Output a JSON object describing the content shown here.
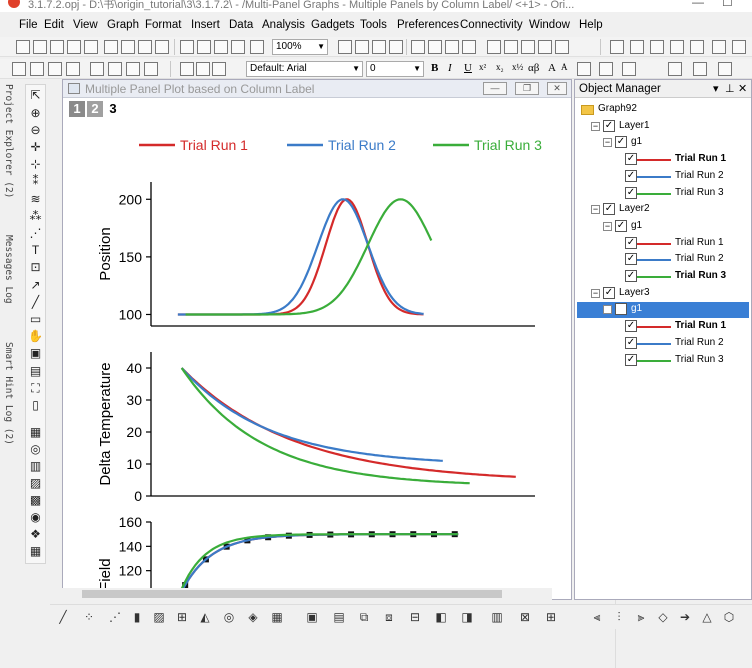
{
  "window": {
    "title": "3.1.7.2.opj - D:\\书\\origin_tutorial\\3\\3.1.7.2\\ - /Multi-Panel Graphs - Multiple Panels by Column Label/ <+1> - Ori..."
  },
  "menu": [
    "File",
    "Edit",
    "View",
    "Graph",
    "Format",
    "Insert",
    "Data",
    "Analysis",
    "Gadgets",
    "Tools",
    "Preferences",
    "Connectivity",
    "Window",
    "Help"
  ],
  "toolbar": {
    "zoom": "100%",
    "font": "Default: Arial",
    "font_size": "0",
    "bold": "B",
    "italic": "I",
    "underline": "U",
    "greek": "αβ"
  },
  "left_dock": {
    "tabs": [
      "Project Explorer (2)",
      "Messages Log",
      "Smart Hint Log (2)"
    ]
  },
  "graph_window": {
    "title": "Multiple Panel Plot based on Column Label",
    "layer_tabs": [
      "1",
      "2",
      "3"
    ],
    "active_layer": "3"
  },
  "colors": {
    "trial1": "#d42a2a",
    "trial2": "#3b7bc8",
    "trial3": "#3aad3a",
    "selection": "#3a7fd5"
  },
  "legend": [
    "Trial Run 1",
    "Trial Run 2",
    "Trial Run 3"
  ],
  "chart_data": [
    {
      "type": "line",
      "ylabel": "Position",
      "ylim": [
        90,
        215
      ],
      "yticks": [
        "200",
        "150",
        "100"
      ],
      "xlim": [
        0,
        10
      ],
      "series": [
        {
          "name": "Trial Run 1",
          "shape": "gaussian",
          "center": 5.1,
          "width": 0.55,
          "base": 100,
          "peak": 200
        },
        {
          "name": "Trial Run 2",
          "shape": "gaussian",
          "center": 5.0,
          "width": 0.65,
          "base": 100,
          "peak": 200
        },
        {
          "name": "Trial Run 3",
          "shape": "gaussian",
          "center": 6.5,
          "width": 0.85,
          "base": 100,
          "peak": 200
        }
      ]
    },
    {
      "type": "line",
      "ylabel": "Delta Temperature",
      "ylim": [
        0,
        45
      ],
      "yticks": [
        "40",
        "30",
        "20",
        "10",
        "0"
      ],
      "xlim": [
        0,
        10
      ],
      "series": [
        {
          "name": "Trial Run 1",
          "shape": "decay",
          "start": 40,
          "end": 6,
          "x_end": 9.5
        },
        {
          "name": "Trial Run 2",
          "shape": "decay",
          "start": 40,
          "end": 11,
          "x_end": 7.6
        },
        {
          "name": "Trial Run 3",
          "shape": "decay",
          "start": 40,
          "end": 4,
          "x_end": 8.3
        }
      ]
    },
    {
      "type": "line",
      "ylabel": "c Field",
      "ylim": [
        100,
        160
      ],
      "yticks": [
        "160",
        "140",
        "120"
      ],
      "xlim": [
        0,
        10
      ],
      "series": [
        {
          "name": "Trial Run 1",
          "shape": "saturate",
          "start": 103,
          "end": 150,
          "symbols": true
        },
        {
          "name": "Trial Run 2",
          "shape": "saturate",
          "start": 103,
          "end": 150
        },
        {
          "name": "Trial Run 3",
          "shape": "saturate",
          "start": 105,
          "end": 150
        }
      ]
    }
  ],
  "object_manager": {
    "title": "Object Manager",
    "tree": [
      {
        "label": "Graph92",
        "level": 0,
        "kind": "folder"
      },
      {
        "label": "Layer1",
        "level": 1,
        "kind": "layer"
      },
      {
        "label": "g1",
        "level": 2,
        "kind": "group"
      },
      {
        "label": "Trial Run 1",
        "level": 3,
        "kind": "plot",
        "series": "trial1",
        "bold": true
      },
      {
        "label": "Trial Run 2",
        "level": 3,
        "kind": "plot",
        "series": "trial2"
      },
      {
        "label": "Trial Run 3",
        "level": 3,
        "kind": "plot",
        "series": "trial3"
      },
      {
        "label": "Layer2",
        "level": 1,
        "kind": "layer"
      },
      {
        "label": "g1",
        "level": 2,
        "kind": "group"
      },
      {
        "label": "Trial Run 1",
        "level": 3,
        "kind": "plot",
        "series": "trial1"
      },
      {
        "label": "Trial Run 2",
        "level": 3,
        "kind": "plot",
        "series": "trial2"
      },
      {
        "label": "Trial Run 3",
        "level": 3,
        "kind": "plot",
        "series": "trial3",
        "bold": true
      },
      {
        "label": "Layer3",
        "level": 1,
        "kind": "layer"
      },
      {
        "label": "g1",
        "level": 2,
        "kind": "group",
        "selected": true
      },
      {
        "label": "Trial Run 1",
        "level": 3,
        "kind": "plot",
        "series": "trial1",
        "bold": true
      },
      {
        "label": "Trial Run 2",
        "level": 3,
        "kind": "plot",
        "series": "trial2"
      },
      {
        "label": "Trial Run 3",
        "level": 3,
        "kind": "plot",
        "series": "trial3"
      }
    ]
  }
}
